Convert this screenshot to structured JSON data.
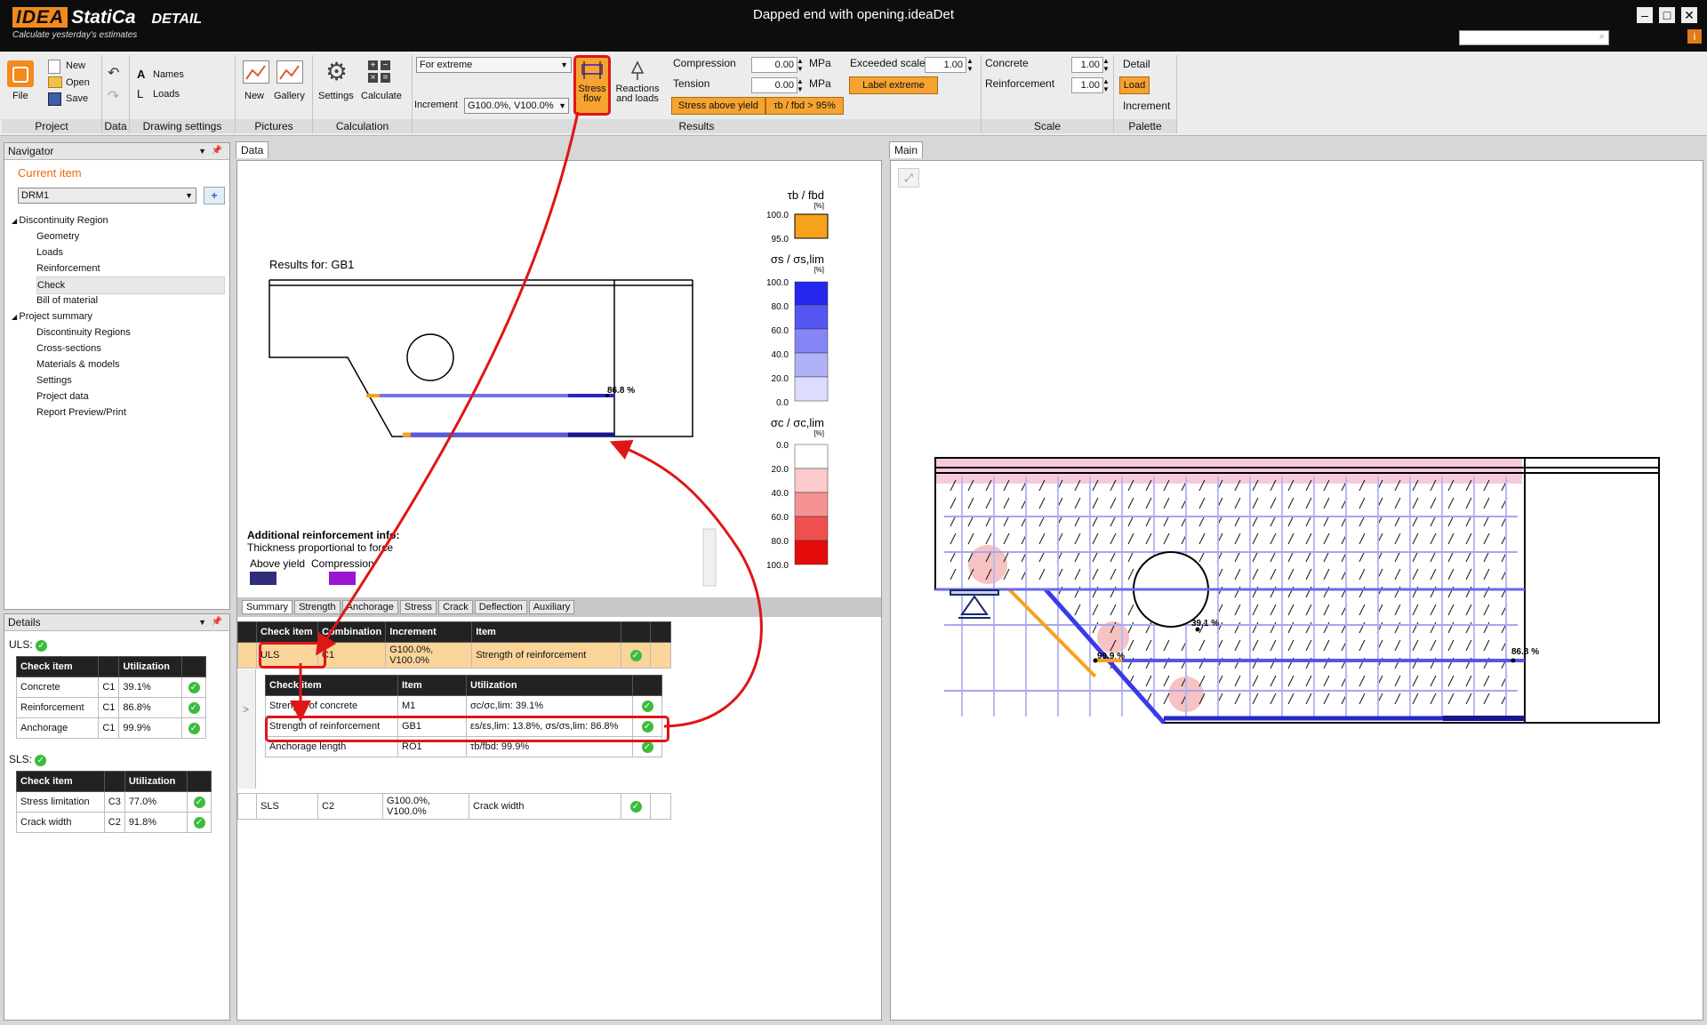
{
  "app": {
    "logo_idea": "IDEA",
    "logo_statica": "StatiCa",
    "logo_detail": "DETAIL",
    "slogan": "Calculate yesterday's estimates",
    "window_title": "Dapped end with opening.ideaDet",
    "info_icon": "i",
    "accent": "#f28a1e"
  },
  "ribbon": {
    "project": {
      "title": "Project",
      "file": "File",
      "new": "New",
      "open": "Open",
      "save": "Save"
    },
    "data": {
      "title": "Data"
    },
    "drawing": {
      "title": "Drawing settings",
      "names": "Names",
      "loads": "Loads"
    },
    "pictures": {
      "title": "Pictures",
      "new": "New",
      "gallery": "Gallery"
    },
    "calculation": {
      "title": "Calculation",
      "settings": "Settings",
      "calculate": "Calculate"
    },
    "results": {
      "title": "Results",
      "mode": "For extreme",
      "increment_label": "Increment",
      "increment_value": "G100.0%, V100.0%",
      "stress_flow_1": "Stress",
      "stress_flow_2": "flow",
      "reactions_1": "Reactions",
      "reactions_2": "and loads",
      "compression": "Compression",
      "compression_value": "0.00",
      "tension": "Tension",
      "tension_value": "0.00",
      "unit": "MPa",
      "stress_above_yield": "Stress above yield",
      "tb_fbd": "τb / fbd > 95%",
      "exceeded_scale": "Exceeded scale",
      "exceeded_value": "1.00",
      "label_extreme": "Label extreme"
    },
    "scale": {
      "title": "Scale",
      "concrete": "Concrete",
      "concrete_value": "1.00",
      "reinforcement": "Reinforcement",
      "reinforcement_value": "1.00"
    },
    "palette": {
      "title": "Palette",
      "detail": "Detail",
      "load": "Load",
      "increment": "Increment"
    }
  },
  "navigator": {
    "title": "Navigator",
    "current_item": "Current item",
    "selected": "DRM1",
    "tree": [
      {
        "label": "Discontinuity Region",
        "level": 0
      },
      {
        "label": "Geometry",
        "level": 1
      },
      {
        "label": "Loads",
        "level": 1
      },
      {
        "label": "Reinforcement",
        "level": 1
      },
      {
        "label": "Check",
        "level": 1
      },
      {
        "label": "Bill of material",
        "level": 1
      },
      {
        "label": "Project summary",
        "level": 0
      },
      {
        "label": "Discontinuity Regions",
        "level": 1
      },
      {
        "label": "Cross-sections",
        "level": 1
      },
      {
        "label": "Materials & models",
        "level": 1
      },
      {
        "label": "Settings",
        "level": 1
      },
      {
        "label": "Project data",
        "level": 1
      },
      {
        "label": "Report Preview/Print",
        "level": 1
      }
    ]
  },
  "details": {
    "title": "Details",
    "uls_label": "ULS:",
    "sls_label": "SLS:",
    "col_check": "Check item",
    "col_util": "Utilization",
    "uls_rows": [
      {
        "item": "Concrete",
        "comb": "C1",
        "util": "39.1%"
      },
      {
        "item": "Reinforcement",
        "comb": "C1",
        "util": "86.8%"
      },
      {
        "item": "Anchorage",
        "comb": "C1",
        "util": "99.9%"
      }
    ],
    "sls_rows": [
      {
        "item": "Stress limitation",
        "comb": "C3",
        "util": "77.0%"
      },
      {
        "item": "Crack width",
        "comb": "C2",
        "util": "91.8%"
      }
    ]
  },
  "data_panel": {
    "tab": "Data",
    "results_for": "Results for: GB1",
    "label_868": "86.8 %",
    "legend": {
      "tb_title": "τb / fbd",
      "pct": "[%]",
      "tb_ticks": [
        "100.0",
        "95.0"
      ],
      "ss_title": "σs / σs,lim",
      "ss_ticks": [
        "100.0",
        "80.0",
        "60.0",
        "40.0",
        "20.0",
        "0.0"
      ],
      "sc_title": "σc / σc,lim",
      "sc_ticks": [
        "0.0",
        "20.0",
        "40.0",
        "60.0",
        "80.0",
        "100.0"
      ]
    },
    "add_info_title": "Additional reinforcement info:",
    "add_info_sub": "Thickness proportional to force",
    "above_yield": "Above yield",
    "compression": "Compression",
    "colors": {
      "tb": "#f7a21b",
      "above_yield": "#2e2e7a",
      "compression": "#9b16d1"
    }
  },
  "result_tabs": [
    "Summary",
    "Strength",
    "Anchorage",
    "Stress",
    "Crack",
    "Deflection",
    "Auxiliary"
  ],
  "summary_table": {
    "headers": [
      "Check item",
      "Combination",
      "Increment",
      "Item"
    ],
    "uls": {
      "check": "ULS",
      "comb": "C1",
      "inc": "G100.0%, V100.0%",
      "item": "Strength of reinforcement"
    },
    "sls": {
      "check": "SLS",
      "comb": "C2",
      "inc": "G100.0%, V100.0%",
      "item": "Crack width"
    },
    "sub_headers": [
      "Check item",
      "Item",
      "Utilization"
    ],
    "sub_rows": [
      {
        "check": "Strength of concrete",
        "item": "M1",
        "util": "σc/σc,lim: 39.1%"
      },
      {
        "check": "Strength of reinforcement",
        "item": "GB1",
        "util": "εs/εs,lim: 13.8%, σs/σs,lim: 86.8%"
      },
      {
        "check": "Anchorage length",
        "item": "RO1",
        "util": "τb/fbd: 99.9%"
      }
    ],
    "expand": ">"
  },
  "main_panel": {
    "tab": "Main",
    "label_999": "99.9 %",
    "label_391": "39.1 %",
    "label_868": "86.8 %"
  }
}
